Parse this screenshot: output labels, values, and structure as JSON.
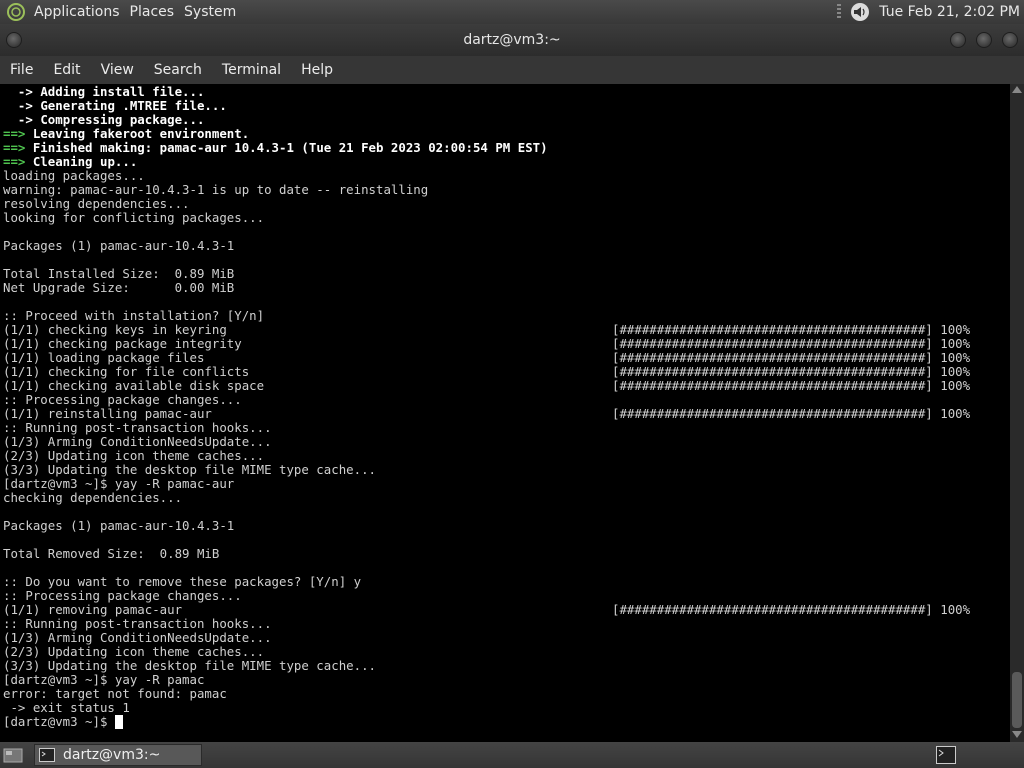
{
  "top_panel": {
    "menus": [
      "Applications",
      "Places",
      "System"
    ],
    "clock": "Tue Feb 21,  2:02 PM"
  },
  "window": {
    "title": "dartz@vm3:~",
    "menubar": [
      "File",
      "Edit",
      "View",
      "Search",
      "Terminal",
      "Help"
    ]
  },
  "terminal": {
    "lines": [
      {
        "segments": [
          {
            "text": "  -> ",
            "style": "b"
          },
          {
            "text": "Adding install file...",
            "style": "b"
          }
        ]
      },
      {
        "segments": [
          {
            "text": "  -> ",
            "style": "b"
          },
          {
            "text": "Generating .MTREE file...",
            "style": "b"
          }
        ]
      },
      {
        "segments": [
          {
            "text": "  -> ",
            "style": "b"
          },
          {
            "text": "Compressing package...",
            "style": "b"
          }
        ]
      },
      {
        "segments": [
          {
            "text": "==> ",
            "style": "g"
          },
          {
            "text": "Leaving fakeroot environment.",
            "style": "b"
          }
        ]
      },
      {
        "segments": [
          {
            "text": "==> ",
            "style": "g"
          },
          {
            "text": "Finished making: pamac-aur 10.4.3-1 (Tue 21 Feb 2023 02:00:54 PM EST)",
            "style": "b"
          }
        ]
      },
      {
        "segments": [
          {
            "text": "==> ",
            "style": "g"
          },
          {
            "text": "Cleaning up...",
            "style": "b"
          }
        ]
      },
      {
        "segments": [
          {
            "text": "loading packages..."
          }
        ]
      },
      {
        "segments": [
          {
            "text": "warning: pamac-aur-10.4.3-1 is up to date -- reinstalling"
          }
        ]
      },
      {
        "segments": [
          {
            "text": "resolving dependencies..."
          }
        ]
      },
      {
        "segments": [
          {
            "text": "looking for conflicting packages..."
          }
        ]
      },
      {
        "segments": [
          {
            "text": ""
          }
        ]
      },
      {
        "segments": [
          {
            "text": "Packages (1) pamac-aur-10.4.3-1"
          }
        ]
      },
      {
        "segments": [
          {
            "text": ""
          }
        ]
      },
      {
        "segments": [
          {
            "text": "Total Installed Size:  0.89 MiB"
          }
        ]
      },
      {
        "segments": [
          {
            "text": "Net Upgrade Size:      0.00 MiB"
          }
        ]
      },
      {
        "segments": [
          {
            "text": ""
          }
        ]
      },
      {
        "segments": [
          {
            "text": ":: Proceed with installation? [Y/n]"
          }
        ]
      },
      {
        "segments": [
          {
            "text": "(1/1) checking keys in keyring"
          }
        ],
        "progress": "[#########################################] 100%"
      },
      {
        "segments": [
          {
            "text": "(1/1) checking package integrity"
          }
        ],
        "progress": "[#########################################] 100%"
      },
      {
        "segments": [
          {
            "text": "(1/1) loading package files"
          }
        ],
        "progress": "[#########################################] 100%"
      },
      {
        "segments": [
          {
            "text": "(1/1) checking for file conflicts"
          }
        ],
        "progress": "[#########################################] 100%"
      },
      {
        "segments": [
          {
            "text": "(1/1) checking available disk space"
          }
        ],
        "progress": "[#########################################] 100%"
      },
      {
        "segments": [
          {
            "text": ":: Processing package changes..."
          }
        ]
      },
      {
        "segments": [
          {
            "text": "(1/1) reinstalling pamac-aur"
          }
        ],
        "progress": "[#########################################] 100%"
      },
      {
        "segments": [
          {
            "text": ":: Running post-transaction hooks..."
          }
        ]
      },
      {
        "segments": [
          {
            "text": "(1/3) Arming ConditionNeedsUpdate..."
          }
        ]
      },
      {
        "segments": [
          {
            "text": "(2/3) Updating icon theme caches..."
          }
        ]
      },
      {
        "segments": [
          {
            "text": "(3/3) Updating the desktop file MIME type cache..."
          }
        ]
      },
      {
        "segments": [
          {
            "text": "[dartz@vm3 ~]$ yay -R pamac-aur"
          }
        ]
      },
      {
        "segments": [
          {
            "text": "checking dependencies..."
          }
        ]
      },
      {
        "segments": [
          {
            "text": ""
          }
        ]
      },
      {
        "segments": [
          {
            "text": "Packages (1) pamac-aur-10.4.3-1"
          }
        ]
      },
      {
        "segments": [
          {
            "text": ""
          }
        ]
      },
      {
        "segments": [
          {
            "text": "Total Removed Size:  0.89 MiB"
          }
        ]
      },
      {
        "segments": [
          {
            "text": ""
          }
        ]
      },
      {
        "segments": [
          {
            "text": ":: Do you want to remove these packages? [Y/n] y"
          }
        ]
      },
      {
        "segments": [
          {
            "text": ":: Processing package changes..."
          }
        ]
      },
      {
        "segments": [
          {
            "text": "(1/1) removing pamac-aur"
          }
        ],
        "progress": "[#########################################] 100%"
      },
      {
        "segments": [
          {
            "text": ":: Running post-transaction hooks..."
          }
        ]
      },
      {
        "segments": [
          {
            "text": "(1/3) Arming ConditionNeedsUpdate..."
          }
        ]
      },
      {
        "segments": [
          {
            "text": "(2/3) Updating icon theme caches..."
          }
        ]
      },
      {
        "segments": [
          {
            "text": "(3/3) Updating the desktop file MIME type cache..."
          }
        ]
      },
      {
        "segments": [
          {
            "text": "[dartz@vm3 ~]$ yay -R pamac"
          }
        ]
      },
      {
        "segments": [
          {
            "text": "error: target not found: pamac"
          }
        ]
      },
      {
        "segments": [
          {
            "text": " -> exit status 1"
          }
        ]
      },
      {
        "segments": [
          {
            "text": "[dartz@vm3 ~]$ "
          }
        ],
        "cursor": true
      }
    ]
  },
  "taskbar": {
    "window_label": "dartz@vm3:~"
  },
  "icons": {
    "distro": "distro-logo-icon",
    "volume": "volume-icon",
    "show_desktop": "show-desktop-icon",
    "terminal": "terminal-icon"
  }
}
